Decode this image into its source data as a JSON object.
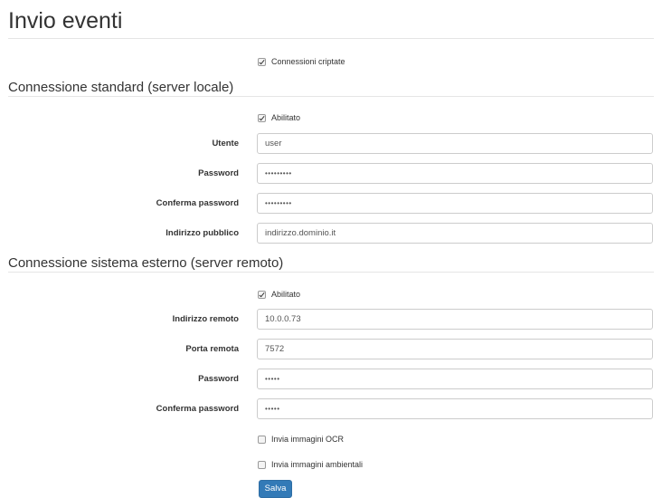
{
  "page": {
    "title": "Invio eventi"
  },
  "encrypted": {
    "label": "Connessioni criptate",
    "checked": true
  },
  "standard": {
    "title": "Connessione standard (server locale)",
    "enabled": {
      "label": "Abilitato",
      "checked": true
    },
    "user": {
      "label": "Utente",
      "value": "user"
    },
    "password": {
      "label": "Password",
      "value": "•••••••••"
    },
    "confirm": {
      "label": "Conferma password",
      "value": "•••••••••"
    },
    "public_address": {
      "label": "Indirizzo pubblico",
      "value": "indirizzo.dominio.it"
    }
  },
  "external": {
    "title": "Connessione sistema esterno (server remoto)",
    "enabled": {
      "label": "Abilitato",
      "checked": true
    },
    "remote_address": {
      "label": "Indirizzo remoto",
      "value": "10.0.0.73"
    },
    "remote_port": {
      "label": "Porta remota",
      "value": "7572"
    },
    "password": {
      "label": "Password",
      "value": "•••••"
    },
    "confirm": {
      "label": "Conferma password",
      "value": "•••••"
    },
    "send_ocr": {
      "label": "Invia immagini OCR",
      "checked": false
    },
    "send_env": {
      "label": "Invia immagini ambientali",
      "checked": false
    }
  },
  "actions": {
    "save_label": "Salva"
  },
  "colors": {
    "primary": "#337ab7",
    "border": "#cccccc",
    "text": "#333333"
  }
}
